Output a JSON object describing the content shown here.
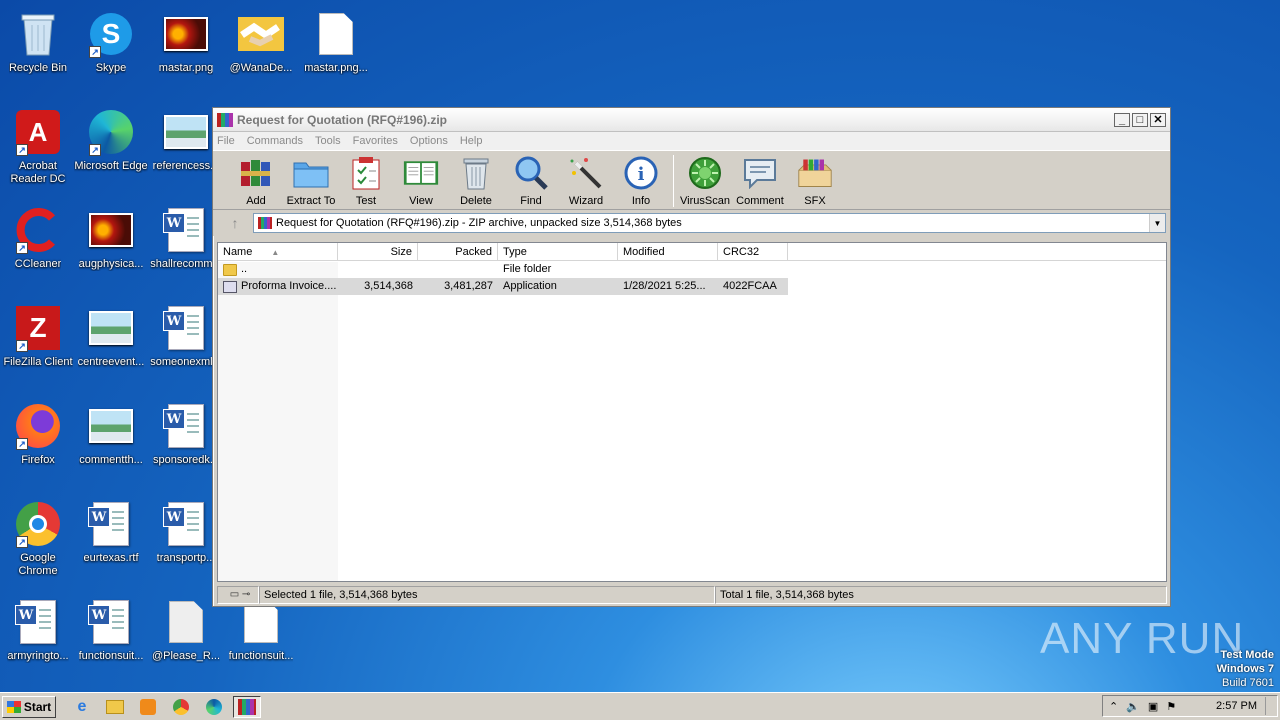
{
  "desktop": {
    "icons": [
      {
        "label": "Recycle Bin"
      },
      {
        "label": "Skype"
      },
      {
        "label": "mastar.png"
      },
      {
        "label": "@WanaDe..."
      },
      {
        "label": "mastar.png..."
      },
      {
        "label": "Acrobat Reader DC"
      },
      {
        "label": "Microsoft Edge"
      },
      {
        "label": "referencess..."
      },
      {
        "label": "CCleaner"
      },
      {
        "label": "augphysica..."
      },
      {
        "label": "shallrecomm..."
      },
      {
        "label": "FileZilla Client"
      },
      {
        "label": "centreevent..."
      },
      {
        "label": "someonexml..."
      },
      {
        "label": "Firefox"
      },
      {
        "label": "commentth..."
      },
      {
        "label": "sponsoredk..."
      },
      {
        "label": "Google Chrome"
      },
      {
        "label": "eurtexas.rtf"
      },
      {
        "label": "transportp..."
      },
      {
        "label": "armyringto..."
      },
      {
        "label": "functionsuit..."
      },
      {
        "label": "@Please_R..."
      },
      {
        "label": "functionsuit..."
      }
    ]
  },
  "window": {
    "title": "Request for Quotation (RFQ#196).zip",
    "menu": [
      "File",
      "Commands",
      "Tools",
      "Favorites",
      "Options",
      "Help"
    ],
    "toolbar": [
      {
        "label": "Add",
        "icon": "add-icon"
      },
      {
        "label": "Extract To",
        "icon": "extract-icon"
      },
      {
        "label": "Test",
        "icon": "test-icon"
      },
      {
        "label": "View",
        "icon": "view-icon"
      },
      {
        "label": "Delete",
        "icon": "delete-icon"
      },
      {
        "label": "Find",
        "icon": "find-icon"
      },
      {
        "label": "Wizard",
        "icon": "wizard-icon"
      },
      {
        "label": "Info",
        "icon": "info-icon"
      },
      {
        "label": "VirusScan",
        "icon": "virusscan-icon"
      },
      {
        "label": "Comment",
        "icon": "comment-icon"
      },
      {
        "label": "SFX",
        "icon": "sfx-icon"
      }
    ],
    "address": "Request for Quotation (RFQ#196).zip - ZIP archive, unpacked size 3,514,368 bytes",
    "columns": {
      "name": "Name",
      "size": "Size",
      "packed": "Packed",
      "type": "Type",
      "modified": "Modified",
      "crc": "CRC32"
    },
    "rows": [
      {
        "name": "..",
        "size": "",
        "packed": "",
        "type": "File folder",
        "modified": "",
        "crc": ""
      },
      {
        "name": "Proforma Invoice....",
        "size": "3,514,368",
        "packed": "3,481,287",
        "type": "Application",
        "modified": "1/28/2021 5:25...",
        "crc": "4022FCAA"
      }
    ],
    "status_left": "Selected 1 file, 3,514,368 bytes",
    "status_right": "Total 1 file, 3,514,368 bytes"
  },
  "taskbar": {
    "start": "Start",
    "clock": "2:57 PM"
  },
  "watermark": {
    "line1": "Test Mode",
    "line2": "Windows 7",
    "line3": "Build 7601",
    "brand": "ANY RUN"
  },
  "colors": {
    "accent": "#1565c0",
    "selection": "#d9d9d9"
  }
}
